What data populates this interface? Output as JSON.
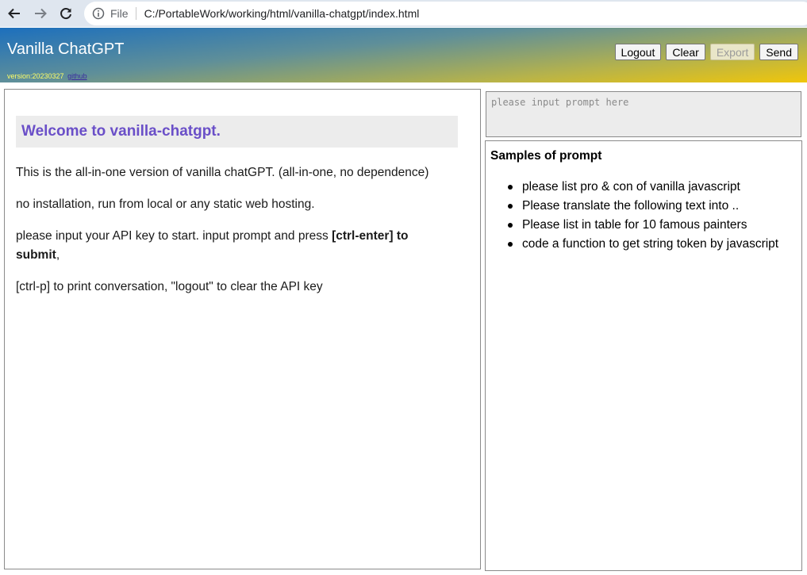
{
  "browser": {
    "file_label": "File",
    "url": "C:/PortableWork/working/html/vanilla-chatgpt/index.html"
  },
  "header": {
    "title": "Vanilla ChatGPT",
    "version": "version:20230327",
    "github_link": "github",
    "buttons": {
      "logout": "Logout",
      "clear": "Clear",
      "export": "Export",
      "send": "Send"
    }
  },
  "conversation": {
    "welcome_heading": "Welcome to vanilla-chatgpt.",
    "para1": "This is the all-in-one version of vanilla chatGPT. (all-in-one, no dependence)",
    "para2": "no installation, run from local or any static web hosting.",
    "para3_prefix": "please input your API key to start. input prompt and press ",
    "para3_bold": "[ctrl-enter] to submit",
    "para3_suffix": ",",
    "para4": "[ctrl-p] to print conversation, \"logout\" to clear the API key"
  },
  "prompt": {
    "placeholder": "please input prompt here",
    "value": ""
  },
  "samples": {
    "title": "Samples of prompt",
    "items": [
      "please list pro & con of vanilla javascript",
      "Please translate the following text into ..",
      "Please list in table for 10 famous painters",
      "code a function to get string token by javascript"
    ]
  },
  "colors": {
    "header_gradient_start": "#1c6fbd",
    "header_gradient_end": "#f0c60a",
    "welcome_text": "#6a4fc8",
    "version_text": "#ffff66"
  }
}
